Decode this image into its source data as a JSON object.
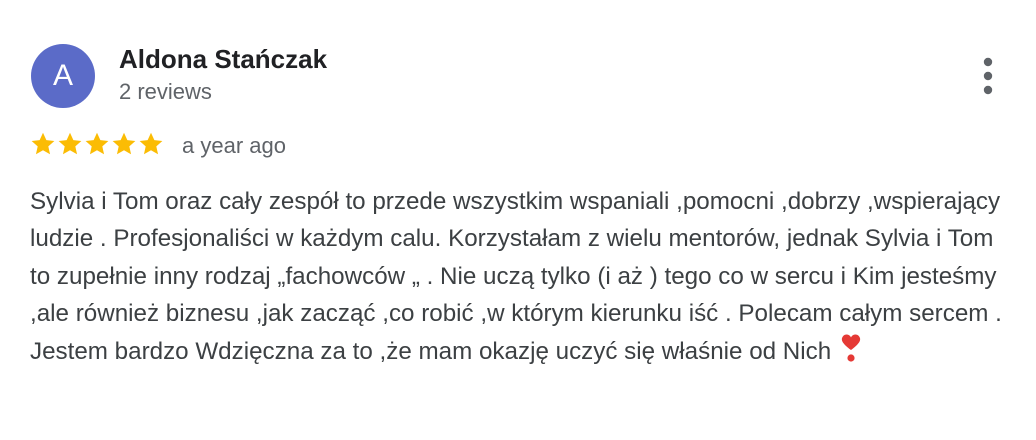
{
  "reviewer": {
    "initial": "A",
    "name": "Aldona Stańczak",
    "reviews_count": "2 reviews",
    "avatar_color": "#5b6bc8"
  },
  "review": {
    "rating": 5,
    "max_rating": 5,
    "time_ago": "a year ago",
    "text": "Sylvia i Tom oraz cały zespół to przede wszystkim wspaniali ,pomocni ,dobrzy ,wspierający ludzie . Profesjonaliści w każdym calu. Korzystałam z wielu mentorów, jednak Sylvia i Tom to zupełnie inny rodzaj „fachowców „ . Nie uczą tylko (i aż ) tego co w sercu i Kim jesteśmy ,ale również biznesu ,jak zacząć ,co robić ,w którym kierunku iść . Polecam całym sercem . Jestem bardzo Wdzięczna za to ,że mam okazję uczyć się właśnie od Nich",
    "emoji_name": "heart-exclamation-icon",
    "star_color": "#fbbc04",
    "emoji_color": "#e53935"
  },
  "menu": {
    "icon_name": "more-vertical-icon"
  }
}
